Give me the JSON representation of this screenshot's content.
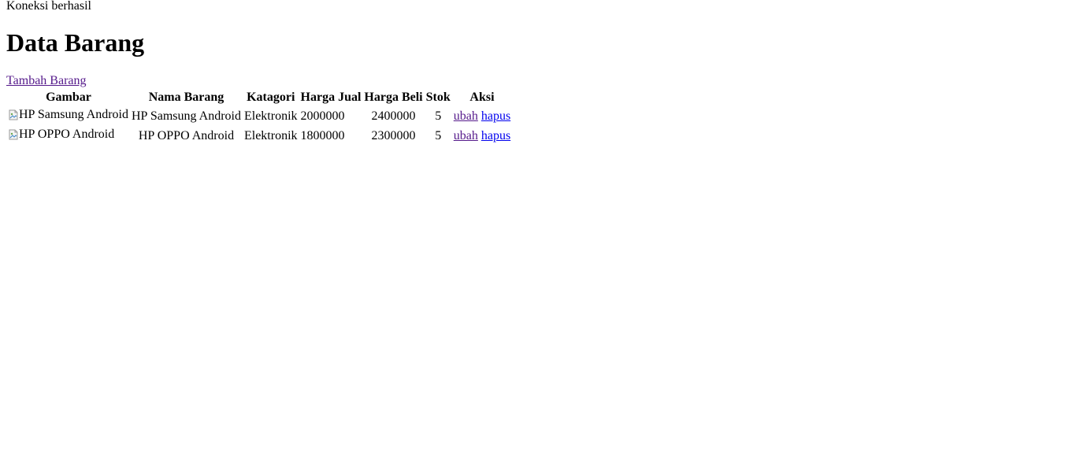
{
  "status": {
    "connection_text": "Koneksi berhasil"
  },
  "page": {
    "title": "Data Barang",
    "add_link_label": "Tambah Barang"
  },
  "table": {
    "headers": {
      "image": "Gambar",
      "name": "Nama Barang",
      "category": "Katagori",
      "sell_price": "Harga Jual",
      "buy_price": "Harga Beli",
      "stock": "Stok",
      "actions": "Aksi"
    },
    "rows": [
      {
        "image_alt": "HP Samsung Android",
        "name": "HP Samsung Android",
        "category": "Elektronik",
        "sell_price": "2000000",
        "buy_price": "2400000",
        "stock": "5",
        "edit_label": "ubah",
        "delete_label": "hapus"
      },
      {
        "image_alt": "HP OPPO Android",
        "name": "HP OPPO Android",
        "category": "Elektronik",
        "sell_price": "1800000",
        "buy_price": "2300000",
        "stock": "5",
        "edit_label": "ubah",
        "delete_label": "hapus"
      }
    ]
  },
  "icons": {
    "broken_image": "broken-image-icon"
  },
  "colors": {
    "link": "#0000ee",
    "visited_link": "#551a8b",
    "text": "#000000",
    "background": "#ffffff"
  }
}
